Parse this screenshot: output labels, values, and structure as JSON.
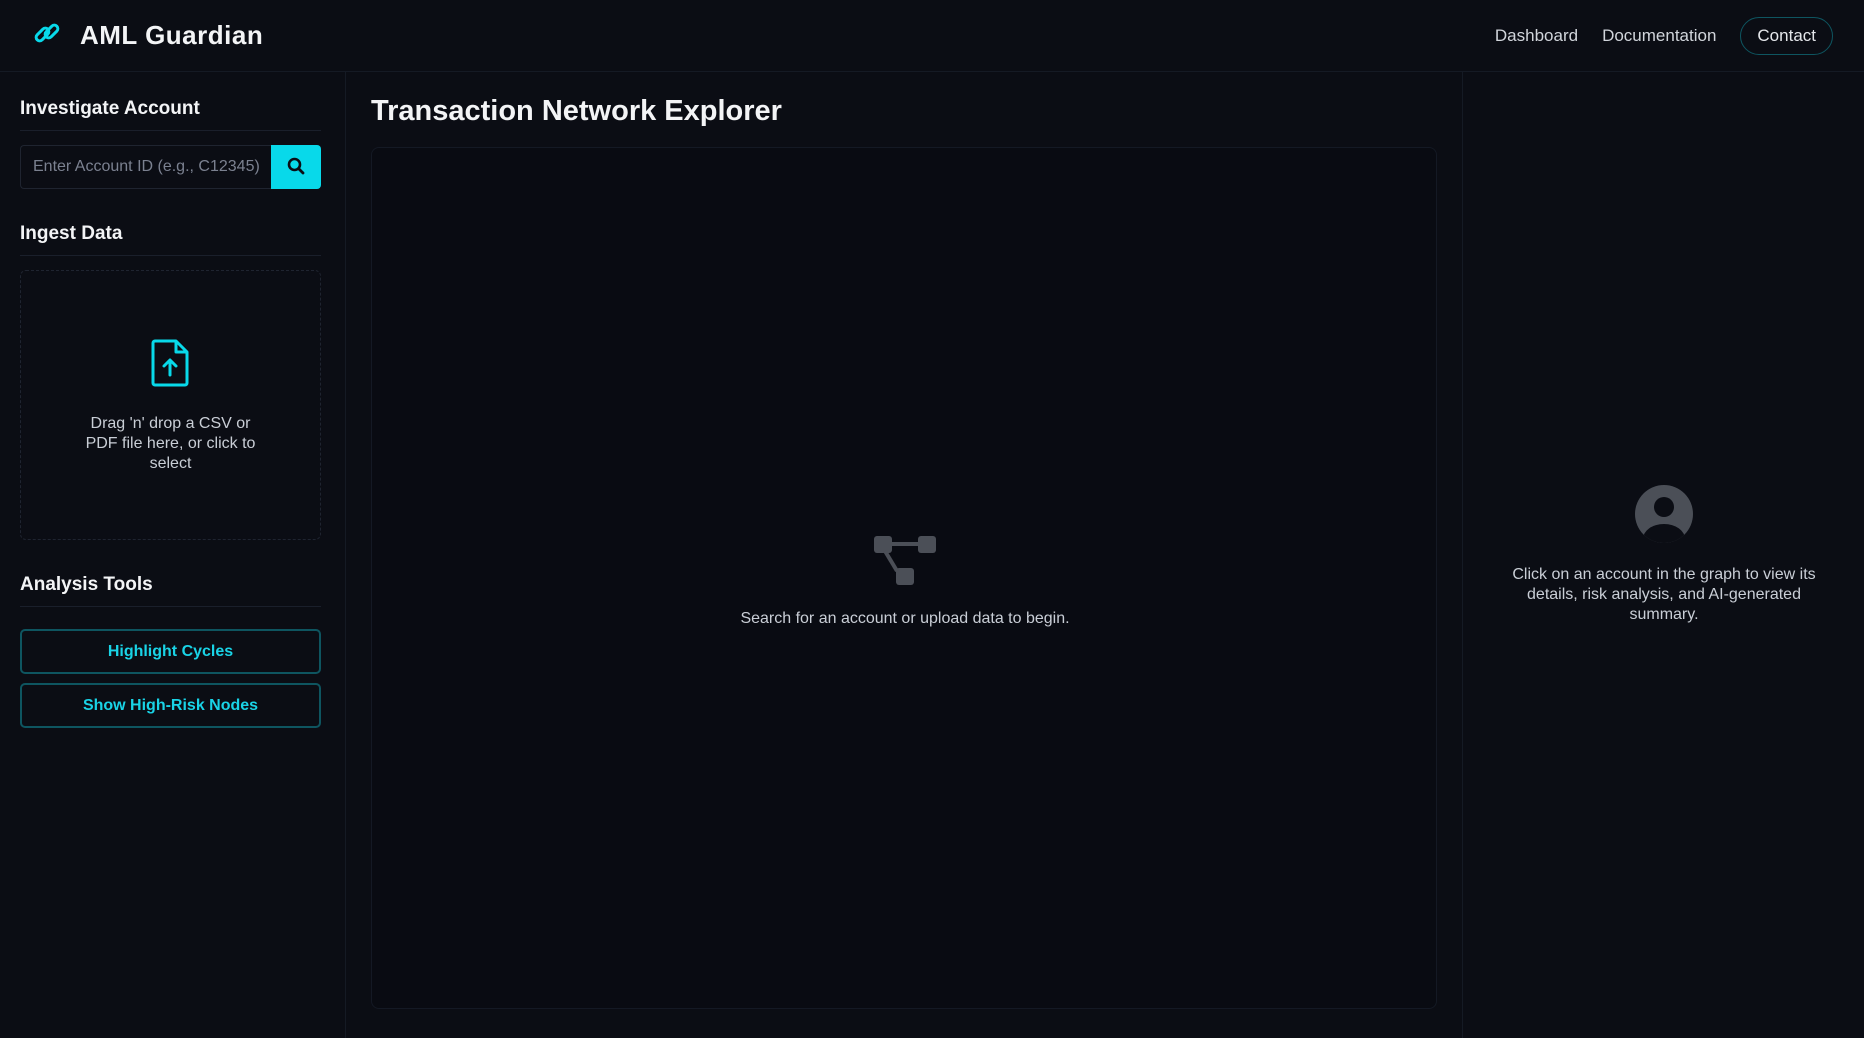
{
  "header": {
    "brand_icon": "link-icon",
    "title": "AML Guardian",
    "nav": {
      "dashboard": "Dashboard",
      "documentation": "Documentation",
      "contact": "Contact"
    }
  },
  "sidebar": {
    "investigate": {
      "title": "Investigate Account",
      "placeholder": "Enter Account ID (e.g., C12345)",
      "search_icon": "search-icon"
    },
    "ingest": {
      "title": "Ingest Data",
      "upload_icon": "file-upload-icon",
      "dropzone_text": "Drag 'n' drop a CSV or PDF file here, or click to select"
    },
    "analysis": {
      "title": "Analysis Tools",
      "highlight_cycles": "Highlight Cycles",
      "show_high_risk": "Show High-Risk Nodes"
    }
  },
  "main": {
    "title": "Transaction Network Explorer",
    "empty_icon": "network-icon",
    "empty_text": "Search for an account or upload data to begin."
  },
  "details": {
    "icon": "user-circle-icon",
    "text": "Click on an account in the graph to view its details, risk analysis, and AI-generated summary."
  },
  "colors": {
    "background": "#0b0d14",
    "accent": "#08d9ea",
    "button_border": "#0e5560",
    "muted_icon": "#4b4f57"
  }
}
